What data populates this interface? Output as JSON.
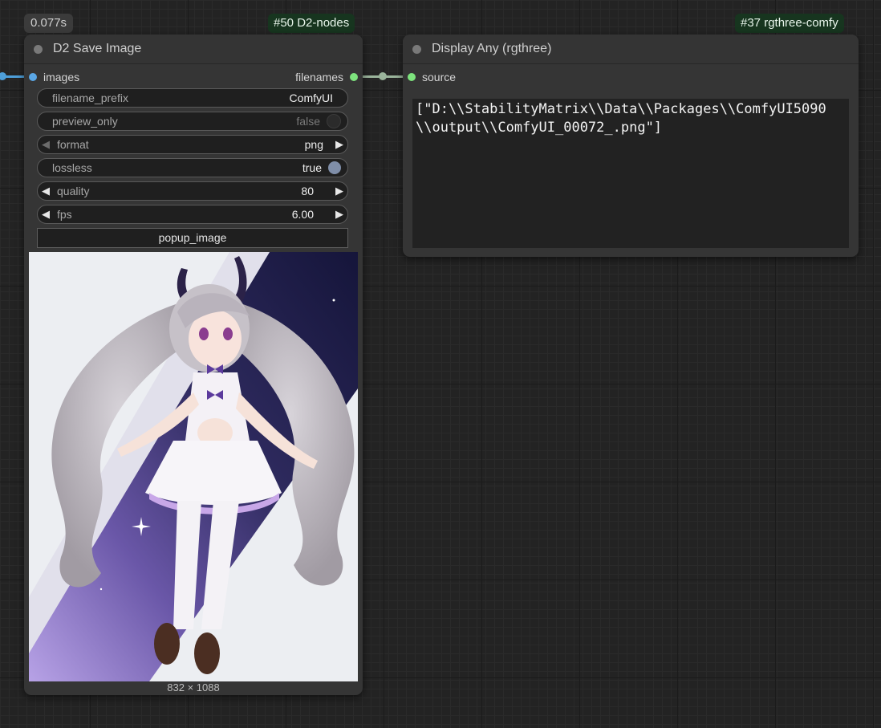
{
  "execution_time": "0.077s",
  "colors": {
    "accent_green_slot": "#7de37d",
    "input_blue_slot": "#5aa7e6",
    "wire_green": "#9bb59c",
    "toggle_off": "#2b2b2b",
    "toggle_on": "#7f8ea8"
  },
  "save_node": {
    "badge": "#50 D2-nodes",
    "title": "D2 Save Image",
    "input_label": "images",
    "output_label": "filenames",
    "widgets": {
      "filename_prefix": {
        "label": "filename_prefix",
        "value": "ComfyUI"
      },
      "preview_only": {
        "label": "preview_only",
        "value": "false"
      },
      "format": {
        "label": "format",
        "value": "png"
      },
      "lossless": {
        "label": "lossless",
        "value": "true"
      },
      "quality": {
        "label": "quality",
        "value": "80"
      },
      "fps": {
        "label": "fps",
        "value": "6.00"
      }
    },
    "popup_button": "popup_image",
    "image_size": "832 × 1088"
  },
  "display_node": {
    "badge": "#37 rgthree-comfy",
    "title": "Display Any (rgthree)",
    "input_label": "source",
    "output_text": "[\"D:\\\\StabilityMatrix\\\\Data\\\\Packages\\\\ComfyUI5090\\\\output\\\\ComfyUI_00072_.png\"]"
  },
  "icons": {
    "collapse_dot": "circle-dot",
    "left_arrow": "◀",
    "right_arrow": "▶"
  }
}
